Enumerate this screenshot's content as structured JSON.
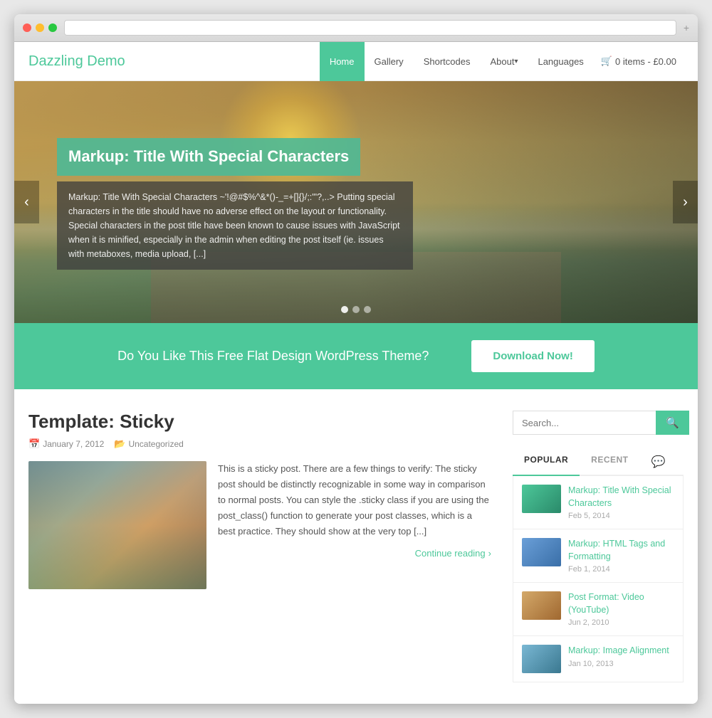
{
  "browser": {
    "url": ""
  },
  "site": {
    "logo": "Dazzling Demo"
  },
  "nav": {
    "items": [
      {
        "label": "Home",
        "active": true
      },
      {
        "label": "Gallery",
        "active": false
      },
      {
        "label": "Shortcodes",
        "active": false
      },
      {
        "label": "About",
        "active": false,
        "hasArrow": true
      },
      {
        "label": "Languages",
        "active": false
      },
      {
        "label": "🛒 0 items - £0.00",
        "active": false
      }
    ]
  },
  "hero": {
    "title": "Markup: Title With Special Characters",
    "description": "Markup: Title With Special Characters ~'!@#$%^&*()-_=+[]{}/;:'\"?,..> Putting special characters in the title should have no adverse effect on the layout or functionality. Special characters in the post title have been known to cause issues with JavaScript when it is minified, especially in the admin when editing the post itself (ie. issues with metaboxes, media upload, [...]"
  },
  "cta": {
    "text": "Do You Like This Free Flat Design WordPress Theme?",
    "button": "Download Now!"
  },
  "post": {
    "title": "Template: Sticky",
    "date": "January 7, 2012",
    "category": "Uncategorized",
    "excerpt": "This is a sticky post. There are a few things to verify: The sticky post should be distinctly recognizable in some way in comparison to normal posts. You can style the .sticky class if you are using the post_class() function to generate your post classes, which is a best practice. They should show at the very top [...]",
    "continue_reading": "Continue reading"
  },
  "sidebar": {
    "search_placeholder": "Search...",
    "tabs": [
      {
        "label": "POPULAR",
        "active": true
      },
      {
        "label": "RECENT",
        "active": false
      },
      {
        "label": "💬",
        "active": false
      }
    ],
    "popular_posts": [
      {
        "title": "Markup: Title With Special Characters",
        "date": "Feb 5, 2014",
        "thumb_class": "sidebar-post-thumb-1"
      },
      {
        "title": "Markup: HTML Tags and Formatting",
        "date": "Feb 1, 2014",
        "thumb_class": "sidebar-post-thumb-2"
      },
      {
        "title": "Post Format: Video (YouTube)",
        "date": "Jun 2, 2010",
        "thumb_class": "sidebar-post-thumb-3"
      },
      {
        "title": "Markup: Image Alignment",
        "date": "Jan 10, 2013",
        "thumb_class": "sidebar-post-thumb-4"
      }
    ]
  },
  "colors": {
    "accent": "#4dc89a"
  }
}
